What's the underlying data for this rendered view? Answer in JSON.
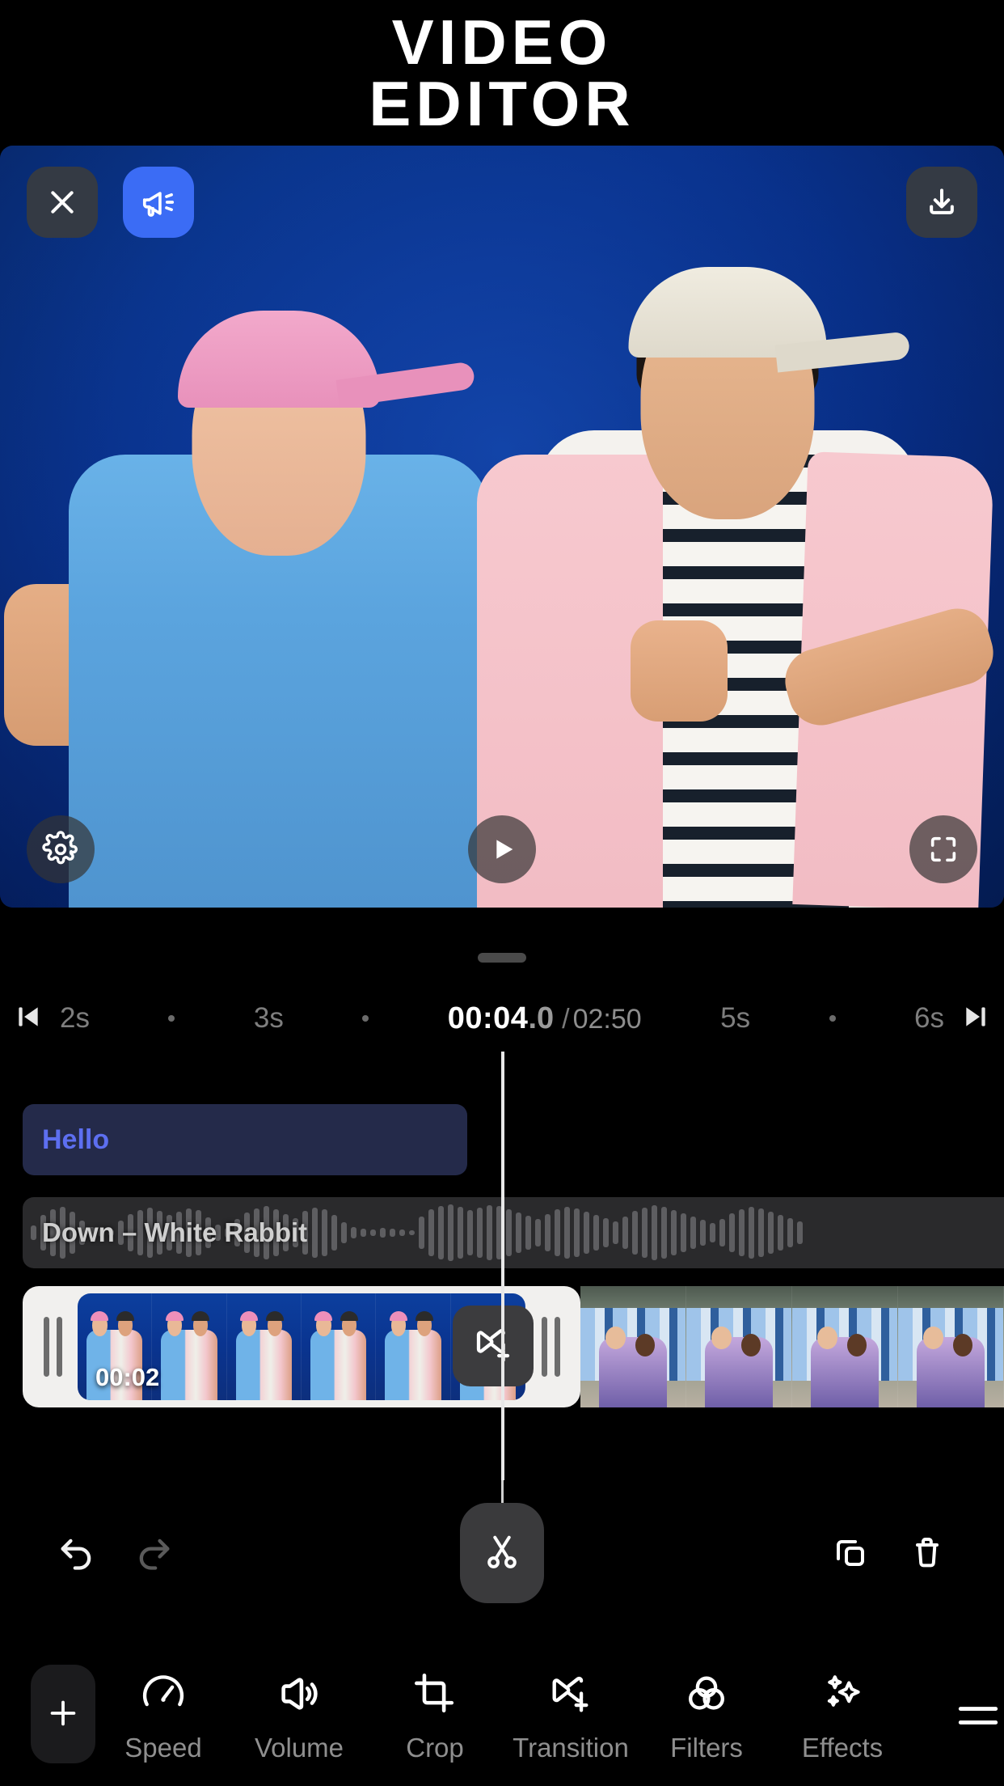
{
  "header": {
    "title_line1": "VIDEO",
    "title_line2": "EDITOR"
  },
  "preview": {
    "close_label": "Close",
    "announce_label": "Announce",
    "export_label": "Export",
    "settings_label": "Settings",
    "play_label": "Play",
    "fullscreen_label": "Fullscreen"
  },
  "ruler": {
    "skip_start_label": "Skip to start",
    "skip_end_label": "Skip to end",
    "ticks": [
      "2s",
      "3s",
      "5s",
      "6s"
    ],
    "current_time": "00:04",
    "current_frac": ".0",
    "separator": "/",
    "total_time": "02:50"
  },
  "tracks": {
    "text_clip": {
      "label": "Hello"
    },
    "audio_clip": {
      "label": "Down – White Rabbit"
    },
    "video_clip": {
      "duration": "00:02"
    },
    "transition_label": "Add transition"
  },
  "actions": {
    "undo_label": "Undo",
    "redo_label": "Redo",
    "split_label": "Split",
    "duplicate_label": "Duplicate",
    "delete_label": "Delete"
  },
  "toolbar": {
    "add_label": "Add",
    "items": [
      {
        "label": "Speed",
        "icon": "speedometer-icon"
      },
      {
        "label": "Volume",
        "icon": "volume-icon"
      },
      {
        "label": "Crop",
        "icon": "crop-icon"
      },
      {
        "label": "Transition",
        "icon": "transition-icon"
      },
      {
        "label": "Filters",
        "icon": "filters-icon"
      },
      {
        "label": "Effects",
        "icon": "effects-icon"
      }
    ]
  },
  "colors": {
    "accent_blue": "#3b6cf5",
    "text_clip_bg": "#242a4a",
    "text_clip_fg": "#5d6ff0",
    "panel_dark": "#343a44",
    "background": "#000000"
  }
}
